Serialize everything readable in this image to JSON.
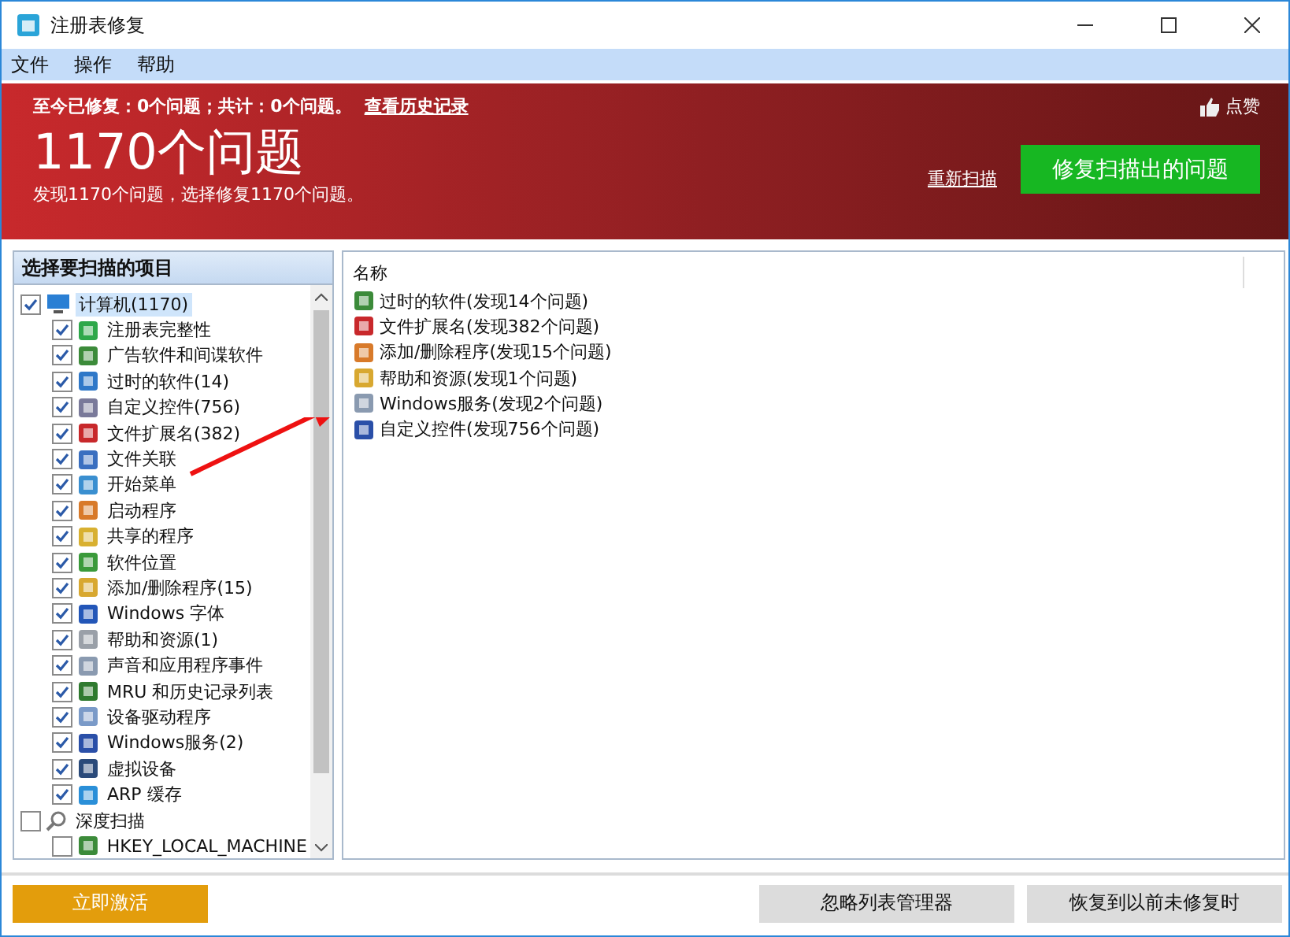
{
  "window": {
    "title": "注册表修复"
  },
  "menu": [
    "文件",
    "操作",
    "帮助"
  ],
  "header": {
    "summary": "至今已修复：0个问题；共计：0个问题。",
    "history_link": "查看历史记录",
    "like": "点赞",
    "count": "1170个问题",
    "subtitle": "发现1170个问题，选择修复1170个问题。",
    "rescan_link": "重新扫描",
    "fix_button": "修复扫描出的问题"
  },
  "scan_panel": {
    "title": "选择要扫描的项目",
    "tree": [
      {
        "label": "计算机(1170)",
        "checked": true,
        "selected": true,
        "children": [
          {
            "label": "注册表完整性",
            "checked": true,
            "selected": false
          },
          {
            "label": "广告软件和间谍软件",
            "checked": true,
            "selected": false
          },
          {
            "label": "过时的软件(14)",
            "checked": true,
            "selected": false
          },
          {
            "label": "自定义控件(756)",
            "checked": true,
            "selected": false
          },
          {
            "label": "文件扩展名(382)",
            "checked": true,
            "selected": false
          },
          {
            "label": "文件关联",
            "checked": true,
            "selected": false
          },
          {
            "label": "开始菜单",
            "checked": true,
            "selected": false
          },
          {
            "label": "启动程序",
            "checked": true,
            "selected": false
          },
          {
            "label": "共享的程序",
            "checked": true,
            "selected": false
          },
          {
            "label": "软件位置",
            "checked": true,
            "selected": false
          },
          {
            "label": "添加/删除程序(15)",
            "checked": true,
            "selected": false
          },
          {
            "label": "Windows 字体",
            "checked": true,
            "selected": false
          },
          {
            "label": "帮助和资源(1)",
            "checked": true,
            "selected": false
          },
          {
            "label": "声音和应用程序事件",
            "checked": true,
            "selected": false
          },
          {
            "label": "MRU 和历史记录列表",
            "checked": true,
            "selected": false
          },
          {
            "label": "设备驱动程序",
            "checked": true,
            "selected": false
          },
          {
            "label": "Windows服务(2)",
            "checked": true,
            "selected": false
          },
          {
            "label": "虚拟设备",
            "checked": true,
            "selected": false
          },
          {
            "label": "ARP 缓存",
            "checked": true,
            "selected": false
          }
        ]
      },
      {
        "label": "深度扫描",
        "checked": false,
        "selected": false,
        "children": [
          {
            "label": "HKEY_LOCAL_MACHINE",
            "checked": false,
            "selected": false
          }
        ]
      }
    ]
  },
  "results": {
    "column": "名称",
    "rows": [
      "过时的软件(发现14个问题)",
      "文件扩展名(发现382个问题)",
      "添加/删除程序(发现15个问题)",
      "帮助和资源(发现1个问题)",
      "Windows服务(发现2个问题)",
      "自定义控件(发现756个问题)"
    ]
  },
  "footer": {
    "activate": "立即激活",
    "ignore_list": "忽略列表管理器",
    "restore": "恢复到以前未修复时"
  }
}
